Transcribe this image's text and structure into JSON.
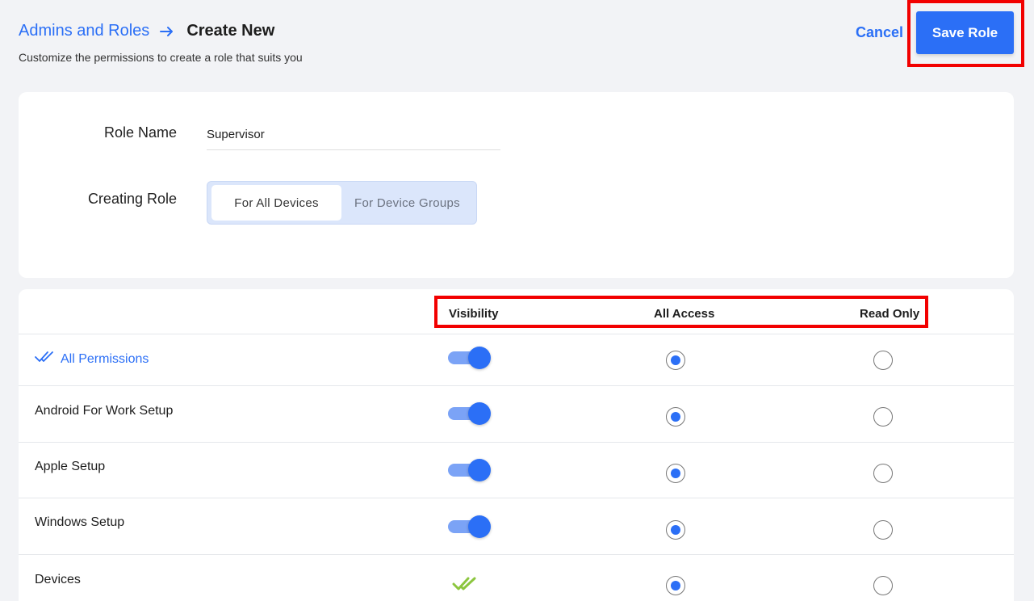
{
  "breadcrumb": {
    "parent": "Admins and Roles",
    "current": "Create New"
  },
  "subtitle": "Customize the permissions to create a role that suits you",
  "actions": {
    "cancel_label": "Cancel",
    "save_label": "Save Role"
  },
  "form": {
    "role_name_label": "Role Name",
    "role_name_value": "Supervisor",
    "creating_role_label": "Creating Role",
    "scope_options": [
      "For All Devices",
      "For Device Groups"
    ],
    "scope_selected": "For All Devices"
  },
  "table": {
    "columns": [
      "Visibility",
      "All Access",
      "Read Only"
    ],
    "rows": [
      {
        "label": "All Permissions",
        "visibility": "toggle-on",
        "access": "all"
      },
      {
        "label": "Android For Work Setup",
        "visibility": "toggle-on",
        "access": "all"
      },
      {
        "label": "Apple Setup",
        "visibility": "toggle-on",
        "access": "all"
      },
      {
        "label": "Windows Setup",
        "visibility": "toggle-on",
        "access": "all"
      },
      {
        "label": "Devices",
        "visibility": "check",
        "access": "all"
      }
    ]
  },
  "colors": {
    "accent": "#2b6ff6",
    "highlight": "#f20000",
    "check_green": "#8cc63f"
  }
}
